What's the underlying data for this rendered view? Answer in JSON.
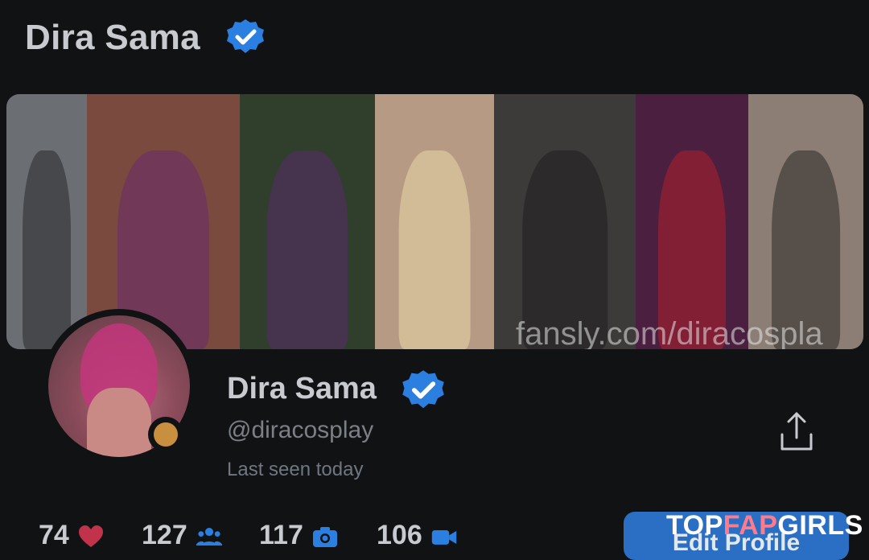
{
  "header": {
    "title": "Dira Sama",
    "verified_icon": "verified-badge-icon"
  },
  "banner": {
    "watermark": "fansly.com/diracospla",
    "panels": [
      {
        "color": "#6b6e72"
      },
      {
        "color": "#7a4a3e"
      },
      {
        "color": "#3e5a3a"
      },
      {
        "color": "#b69a83"
      },
      {
        "color": "#3c3b3a"
      },
      {
        "color": "#4b1f3f"
      },
      {
        "color": "#8d7e75"
      }
    ]
  },
  "profile": {
    "name": "Dira Sama",
    "handle": "@diracosplay",
    "last_seen": "Last seen today",
    "status_color": "#c88f3f"
  },
  "stats": [
    {
      "value": "74",
      "icon": "heart-icon"
    },
    {
      "value": "127",
      "icon": "users-icon"
    },
    {
      "value": "117",
      "icon": "camera-icon"
    },
    {
      "value": "106",
      "icon": "video-icon"
    }
  ],
  "actions": {
    "edit_profile_label": "Edit Profile",
    "share_icon": "share-icon"
  },
  "watermark_logo": {
    "part1": "TOP",
    "part2": "FAP",
    "part3": "GIRLS"
  },
  "colors": {
    "accent": "#2a6fc4",
    "verified": "#2a7fe0",
    "background": "#111214"
  }
}
